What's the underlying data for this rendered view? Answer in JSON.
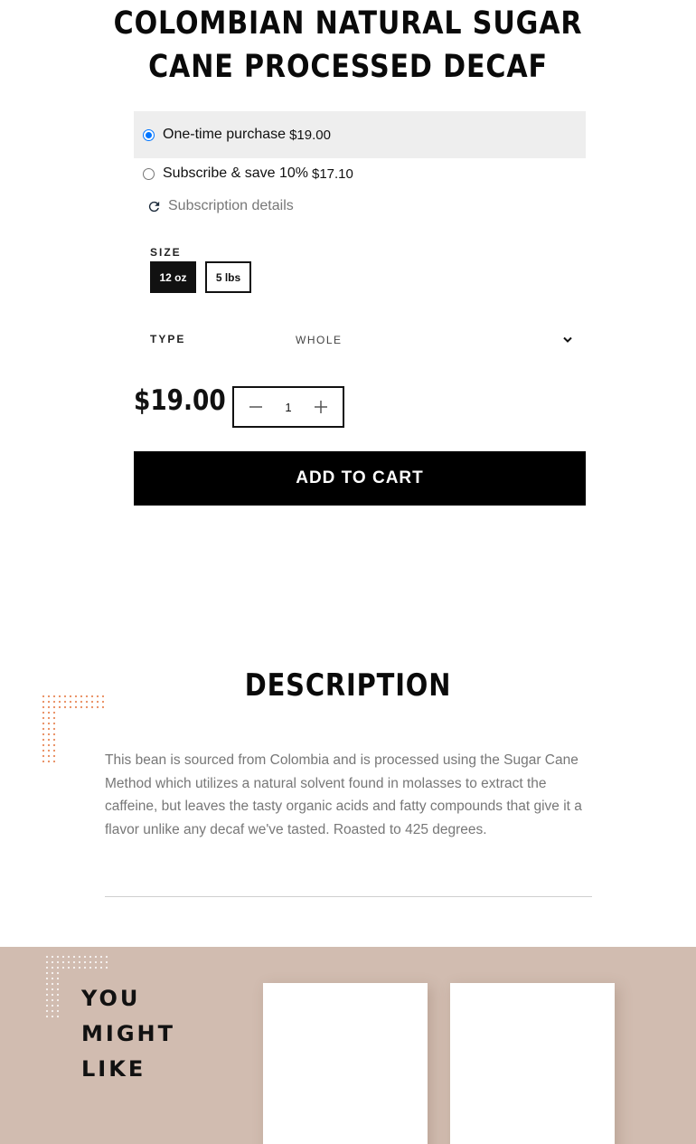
{
  "product": {
    "title_line1": "COLOMBIAN NATURAL SUGAR",
    "title_line2": "CANE PROCESSED DECAF"
  },
  "purchase_options": {
    "one_time_label": "One-time purchase",
    "one_time_price": "$19.00",
    "subscribe_label": "Subscribe & save 10%",
    "subscribe_price": "$17.10",
    "subscription_details": "Subscription details"
  },
  "size": {
    "label": "SIZE",
    "options": [
      "12 oz",
      "5 lbs"
    ],
    "selected": "12 oz"
  },
  "type": {
    "label": "TYPE",
    "selected": "WHOLE"
  },
  "price": "$19.00",
  "quantity": "1",
  "add_to_cart": "ADD TO CART",
  "description": {
    "heading": "DESCRIPTION",
    "text": "This bean is sourced from Colombia and is processed using the Sugar Cane Method which utilizes a natural solvent found in molasses to extract the caffeine, but leaves the tasty organic acids and fatty compounds that give it a flavor unlike any decaf we've tasted. Roasted to 425 degrees."
  },
  "related": {
    "line1": "YOU",
    "line2": "MIGHT",
    "line3": "LIKE"
  },
  "colors": {
    "selected_bg": "#eeeeee",
    "band_bg": "#d1bcb0",
    "dots_orange": "#e8895a",
    "radio_accent": "#0075ff"
  }
}
